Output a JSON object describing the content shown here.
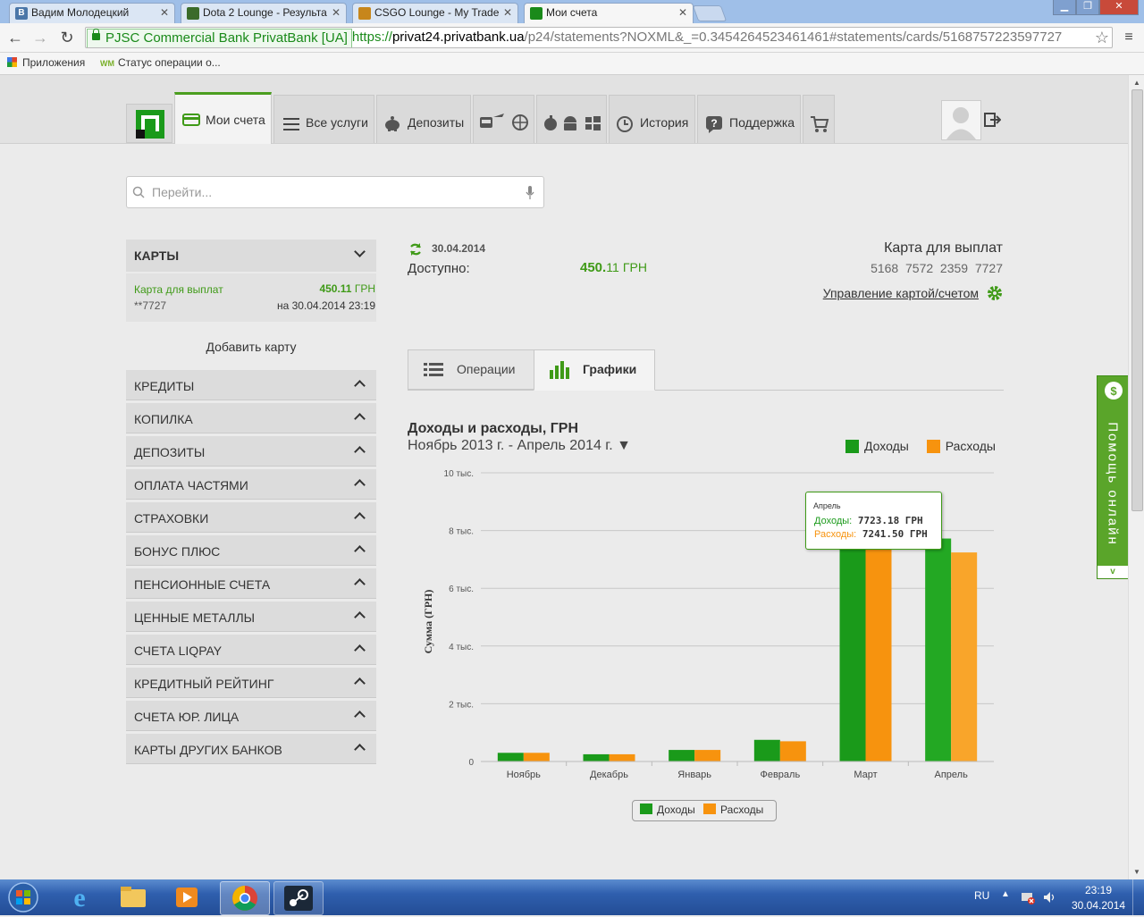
{
  "browser": {
    "tabs": [
      {
        "title": "Вадим Молодецкий",
        "icon": "vk-icon",
        "color": "#4a76a8"
      },
      {
        "title": "Dota 2 Lounge - Результа",
        "icon": "dota-lounge-icon",
        "color": "#3b6b2a"
      },
      {
        "title": "CSGO Lounge - My Trade",
        "icon": "csgo-lounge-icon",
        "color": "#c7861b"
      },
      {
        "title": "Мои счета",
        "icon": "privatbank-icon",
        "color": "#1a8a1a"
      }
    ],
    "ev_label": "PJSC Commercial Bank PrivatBank [UA]",
    "url_scheme": "https://",
    "url_host": "privat24.privatbank.ua",
    "url_path": "/p24/statements?NOXML&_=0.3454264523461461#statements/cards/5168757223597727",
    "bookmarks": [
      "Приложения",
      "Статус операции о..."
    ],
    "bookmark_prefix": "WM"
  },
  "nav": {
    "accounts": "Мои счета",
    "services": "Все услуги",
    "deposits": "Депозиты",
    "history": "История",
    "support": "Поддержка"
  },
  "search": {
    "placeholder": "Перейти..."
  },
  "sidebar": {
    "cards_header": "КАРТЫ",
    "card": {
      "name": "Карта для выплат",
      "number": "**7727",
      "amount_int": "450.",
      "amount_dec": "11",
      "currency": "ГРН",
      "date": "на 30.04.2014 23:19"
    },
    "add_card": "Добавить карту",
    "items": [
      "КРЕДИТЫ",
      "КОПИЛКА",
      "ДЕПОЗИТЫ",
      "ОПЛАТА ЧАСТЯМИ",
      "СТРАХОВКИ",
      "БОНУС ПЛЮС",
      "ПЕНСИОННЫЕ СЧЕТА",
      "ЦЕННЫЕ МЕТАЛЛЫ",
      "СЧЕТА LIQPAY",
      "КРЕДИТНЫЙ РЕЙТИНГ",
      "СЧЕТА ЮР. ЛИЦА",
      "КАРТЫ ДРУГИХ БАНКОВ"
    ]
  },
  "account": {
    "date": "30.04.2014",
    "available_label": "Доступно:",
    "amount_int": "450.",
    "amount_dec": "11",
    "currency": "ГРН",
    "card_title": "Карта для выплат",
    "card_number": "5168  7572  2359  7727",
    "manage_link": "Управление картой/счетом"
  },
  "view_tabs": {
    "operations": "Операции",
    "charts": "Графики"
  },
  "chart_title": "Доходы и расходы, ГРН",
  "period": "Ноябрь 2013 г. - Апрель 2014 г.",
  "chart_data": {
    "type": "bar",
    "categories": [
      "Ноябрь",
      "Декабрь",
      "Январь",
      "Февраль",
      "Март",
      "Апрель"
    ],
    "series": [
      {
        "name": "Доходы",
        "color": "#1a9a1a",
        "values": [
          300,
          250,
          400,
          750,
          7700,
          7723.18
        ]
      },
      {
        "name": "Расходы",
        "color": "#f7930e",
        "values": [
          300,
          250,
          400,
          700,
          7750,
          7241.5
        ]
      }
    ],
    "ylabel": "Сумма (ГРН)",
    "ylim": [
      0,
      10000
    ],
    "yticks": [
      {
        "value": 0,
        "label": "0"
      },
      {
        "value": 2000,
        "label": "2 тыс."
      },
      {
        "value": 4000,
        "label": "4 тыс."
      },
      {
        "value": 6000,
        "label": "6 тыс."
      },
      {
        "value": 8000,
        "label": "8 тыс."
      },
      {
        "value": 10000,
        "label": "10 тыс."
      }
    ],
    "grid": true,
    "legend": "top-right",
    "tooltip": {
      "month": "Апрель",
      "income_label": "Доходы:",
      "income_value": "7723.18 ГРН",
      "expense_label": "Расходы:",
      "expense_value": "7241.50 ГРН"
    }
  },
  "help_label": "Помощь онлайн",
  "taskbar": {
    "lang": "RU",
    "time": "23:19",
    "date": "30.04.2014"
  }
}
